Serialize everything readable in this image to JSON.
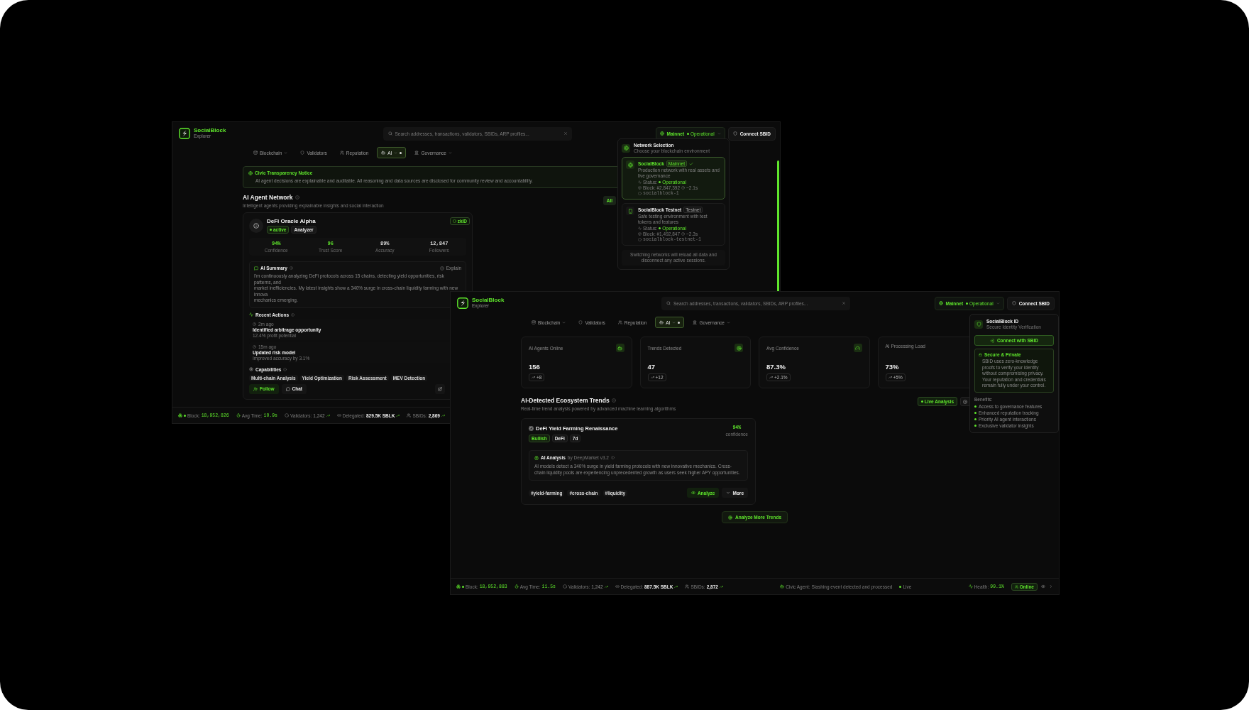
{
  "back_window": {
    "brand": {
      "name": "SocialBlock",
      "tagline": "Explorer"
    },
    "search": {
      "placeholder": "Search addresses, transactions, validators, SBIDs, ARP profiles..."
    },
    "network": {
      "name": "Mainnet",
      "status": "Operational"
    },
    "connect": "Connect SBID",
    "nav": [
      {
        "label": "Blockchain",
        "dropdown": true,
        "selected": false
      },
      {
        "label": "Validators",
        "dropdown": false,
        "selected": false
      },
      {
        "label": "Reputation",
        "dropdown": false,
        "selected": false
      },
      {
        "label": "AI",
        "dropdown": true,
        "selected": true
      },
      {
        "label": "Governance",
        "dropdown": true,
        "selected": false
      }
    ],
    "network_menu": {
      "title": "Network Selection",
      "subtitle": "Choose your blockchain environment",
      "networks": [
        {
          "name": "SocialBlock",
          "badge": "Mainnet",
          "selected": true,
          "description": "Production network with real assets and live governance",
          "status_label": "Status:",
          "status": "Operational",
          "block": "Block: #2,847,392",
          "time": "~2.1s",
          "chain_id": "socialblock-1"
        },
        {
          "name": "SocialBlock Testnet",
          "badge": "Testnet",
          "selected": false,
          "description": "Safe testing environment with test tokens and features",
          "status_label": "Status:",
          "status": "Operational",
          "block": "Block: #1,492,847",
          "time": "~2.3s",
          "chain_id": "socialblock-testnet-1"
        }
      ],
      "footer": "Switching networks will reload all data and disconnect any active sessions."
    },
    "notice": {
      "title": "Civic Transparency Notice",
      "text": "AI agent decisions are explainable and auditable. All reasoning and data sources are disclosed for community review and accountability."
    },
    "section": {
      "title": "AI Agent Network",
      "subtitle": "Intelligent agents providing explainable insights and social interaction",
      "filter": "All"
    },
    "agent": {
      "name": "DeFi Oracle Alpha",
      "status": "active",
      "role": "Analyzer",
      "badge": "zkID",
      "metrics": [
        {
          "value": "94%",
          "label": "Confidence",
          "accent": true
        },
        {
          "value": "96",
          "label": "Trust Score",
          "accent": true
        },
        {
          "value": "89%",
          "label": "Accuracy",
          "accent": false
        },
        {
          "value": "12,847",
          "label": "Followers",
          "accent": false
        }
      ],
      "summary": {
        "title": "AI Summary",
        "action": "Explain",
        "text": "I'm continuously analyzing DeFi protocols across 15 chains, detecting yield opportunities, risk patterns, and\nmarket inefficiencies. My latest insights show a 340% surge in cross-chain liquidity farming with new innova\nmechanics emerging."
      },
      "actions_title": "Recent Actions",
      "actions": [
        {
          "time": "2m ago",
          "title": "Identified arbitrage opportunity",
          "detail": "12.4% profit potential"
        },
        {
          "time": "15m ago",
          "title": "Updated risk model",
          "detail": "Improved accuracy by 3.1%"
        }
      ],
      "capabilities_title": "Capabilities",
      "capabilities": [
        "Multi-chain Analysis",
        "Yield Optimization",
        "Risk Assessment",
        "MEV Detection"
      ],
      "buttons": [
        {
          "label": "Follow",
          "kind": "primary"
        },
        {
          "label": "Chat",
          "kind": "secondary"
        }
      ]
    },
    "status_bar": [
      {
        "label": "Block:",
        "value": "18,952,826",
        "kind": "accent",
        "trend": false
      },
      {
        "label": "Avg Time:",
        "value": "10.9s",
        "kind": "accent",
        "trend": false
      },
      {
        "label": "Validators:",
        "value": "1,242",
        "kind": "muted",
        "trend": true
      },
      {
        "label": "Delegated:",
        "value": "829.5K SBLK",
        "kind": "strong",
        "trend": true
      },
      {
        "label": "SBIDs:",
        "value": "2,869",
        "kind": "strong",
        "trend": true
      }
    ]
  },
  "front_window": {
    "brand": {
      "name": "SocialBlock",
      "tagline": "Explorer"
    },
    "search": {
      "placeholder": "Search addresses, transactions, validators, SBIDs, ARP profiles..."
    },
    "network": {
      "name": "Mainnet",
      "status": "Operational"
    },
    "connect": "Connect SBID",
    "nav": [
      {
        "label": "Blockchain",
        "dropdown": true,
        "selected": false
      },
      {
        "label": "Validators",
        "dropdown": false,
        "selected": false
      },
      {
        "label": "Reputation",
        "dropdown": false,
        "selected": false
      },
      {
        "label": "AI",
        "dropdown": true,
        "selected": true
      },
      {
        "label": "Governance",
        "dropdown": true,
        "selected": false
      }
    ],
    "sbid_menu": {
      "title": "SocialBlock ID",
      "subtitle": "Secure Identity Verification",
      "button": "Connect with SBID",
      "secure_title": "Secure & Private",
      "secure_text": "SBID uses zero-knowledge proofs to verify your identity without compromising privacy. Your reputation and credentials remain fully under your control.",
      "benefits_title": "Benefits:",
      "benefits": [
        "Access to governance features",
        "Enhanced reputation tracking",
        "Priority AI agent interactions",
        "Exclusive validator insights"
      ]
    },
    "stats": [
      {
        "label": "AI Agents Online",
        "value": "156",
        "delta": "+8"
      },
      {
        "label": "Trends Detected",
        "value": "47",
        "delta": "+12"
      },
      {
        "label": "Avg Confidence",
        "value": "87.3%",
        "delta": "+2.1%"
      },
      {
        "label": "AI Processing Load",
        "value": "73%",
        "delta": "+5%"
      }
    ],
    "trends": {
      "title": "AI-Detected Ecosystem Trends",
      "subtitle": "Real-time trend analysis powered by advanced machine learning algorithms",
      "live": "Live Analysis"
    },
    "trend_card": {
      "title": "DeFi Yield Farming Renaissance",
      "tags": [
        {
          "label": "Bullish",
          "kind": "sentiment"
        },
        {
          "label": "DeFi",
          "kind": "plain"
        },
        {
          "label": "7d",
          "kind": "plain"
        }
      ],
      "score": "94%",
      "score_label": "confidence",
      "analysis": {
        "title": "AI Analysis",
        "source": "by DeepMarket v3.2",
        "text": "AI models detect a 340% surge in yield farming protocols with new innovative mechanics. Cross-chain liquidity pools are experiencing unprecedented growth as users seek higher APY opportunities."
      },
      "hashtags": [
        "#yield-farming",
        "#cross-chain",
        "#liquidity"
      ],
      "actions": [
        {
          "label": "Analyze",
          "kind": "primary"
        },
        {
          "label": "More",
          "kind": "secondary"
        }
      ]
    },
    "more_button": "Analyze More Trends",
    "status_bar": [
      {
        "label": "Block:",
        "value": "18,952,883",
        "kind": "accent",
        "trend": false
      },
      {
        "label": "Avg Time:",
        "value": "11.5s",
        "kind": "accent",
        "trend": false
      },
      {
        "label": "Validators:",
        "value": "1,242",
        "kind": "muted",
        "trend": true
      },
      {
        "label": "Delegated:",
        "value": "887.5K SBLK",
        "kind": "strong",
        "trend": true
      },
      {
        "label": "SBIDs:",
        "value": "2,872",
        "kind": "strong",
        "trend": true
      }
    ],
    "agent_event": {
      "label": "Civic Agent:",
      "message": "Slashing event detected and processed"
    },
    "live": "Live",
    "health": {
      "label": "Health:",
      "value": "99.1%"
    },
    "online": "Online"
  }
}
